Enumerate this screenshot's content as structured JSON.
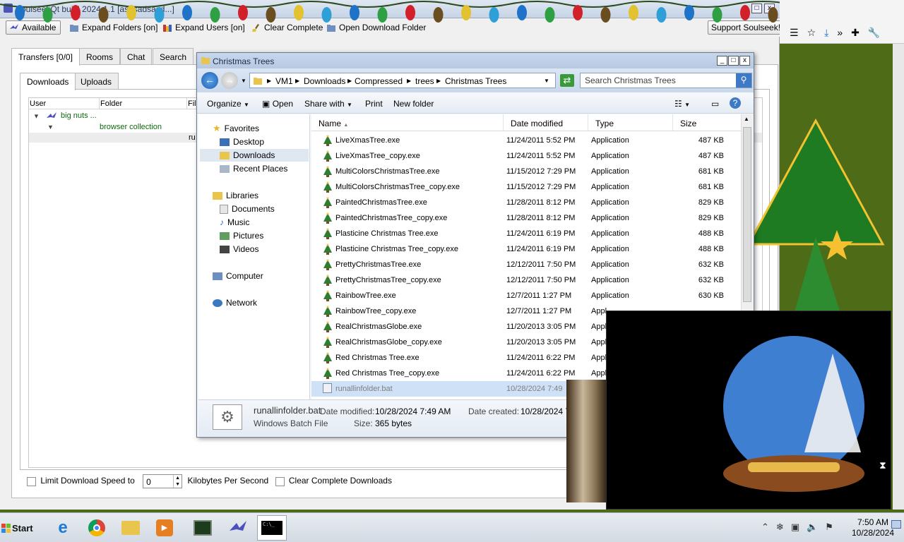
{
  "soulseek": {
    "title": "SoulseekQt build 2024.1.1 [asdsadsasd...]",
    "toolbar": {
      "available": "Available",
      "expand_folders": "Expand Folders [on]",
      "expand_users": "Expand Users [on]",
      "clear_complete": "Clear Complete",
      "open_download_folder": "Open Download Folder",
      "support": "Support Soulseek!"
    },
    "tabs": [
      "Transfers [0/0]",
      "Rooms",
      "Chat",
      "Search"
    ],
    "subtabs": [
      "Downloads",
      "Uploads"
    ],
    "columns": [
      "User",
      "Folder",
      "Fil"
    ],
    "tree": {
      "user": "big nuts ...",
      "folder": "browser collection",
      "file_stub": "ru"
    },
    "bottom": {
      "limit_label": "Limit Download Speed to",
      "speed_value": "0",
      "unit_label": "Kilobytes Per Second",
      "clear_label": "Clear Complete Downloads"
    }
  },
  "explorer": {
    "title": "Christmas Trees",
    "breadcrumb": [
      "VM1",
      "Downloads",
      "Compressed",
      "trees",
      "Christmas Trees"
    ],
    "search_placeholder": "Search Christmas Trees",
    "commands": [
      "Organize",
      "Open",
      "Share with",
      "Print",
      "New folder"
    ],
    "nav": {
      "favorites": "Favorites",
      "desktop": "Desktop",
      "downloads": "Downloads",
      "recent": "Recent Places",
      "libraries": "Libraries",
      "documents": "Documents",
      "music": "Music",
      "pictures": "Pictures",
      "videos": "Videos",
      "computer": "Computer",
      "network": "Network"
    },
    "columns": [
      "Name",
      "Date modified",
      "Type",
      "Size"
    ],
    "files": [
      {
        "name": "LiveXmasTree.exe",
        "date": "11/24/2011 5:52 PM",
        "type": "Application",
        "size": "487 KB"
      },
      {
        "name": "LiveXmasTree_copy.exe",
        "date": "11/24/2011 5:52 PM",
        "type": "Application",
        "size": "487 KB"
      },
      {
        "name": "MultiColorsChristmasTree.exe",
        "date": "11/15/2012 7:29 PM",
        "type": "Application",
        "size": "681 KB"
      },
      {
        "name": "MultiColorsChristmasTree_copy.exe",
        "date": "11/15/2012 7:29 PM",
        "type": "Application",
        "size": "681 KB"
      },
      {
        "name": "PaintedChristmasTree.exe",
        "date": "11/28/2011 8:12 PM",
        "type": "Application",
        "size": "829 KB"
      },
      {
        "name": "PaintedChristmasTree_copy.exe",
        "date": "11/28/2011 8:12 PM",
        "type": "Application",
        "size": "829 KB"
      },
      {
        "name": "Plasticine Christmas Tree.exe",
        "date": "11/24/2011 6:19 PM",
        "type": "Application",
        "size": "488 KB"
      },
      {
        "name": "Plasticine Christmas Tree_copy.exe",
        "date": "11/24/2011 6:19 PM",
        "type": "Application",
        "size": "488 KB"
      },
      {
        "name": "PrettyChristmasTree.exe",
        "date": "12/12/2011 7:50 PM",
        "type": "Application",
        "size": "632 KB"
      },
      {
        "name": "PrettyChristmasTree_copy.exe",
        "date": "12/12/2011 7:50 PM",
        "type": "Application",
        "size": "632 KB"
      },
      {
        "name": "RainbowTree.exe",
        "date": "12/7/2011 1:27 PM",
        "type": "Application",
        "size": "630 KB"
      },
      {
        "name": "RainbowTree_copy.exe",
        "date": "12/7/2011 1:27 PM",
        "type": "Appl",
        "size": ""
      },
      {
        "name": "RealChristmasGlobe.exe",
        "date": "11/20/2013 3:05 PM",
        "type": "Appl",
        "size": ""
      },
      {
        "name": "RealChristmasGlobe_copy.exe",
        "date": "11/20/2013 3:05 PM",
        "type": "Appl",
        "size": ""
      },
      {
        "name": "Red Christmas Tree.exe",
        "date": "11/24/2011 6:22 PM",
        "type": "Appl",
        "size": ""
      },
      {
        "name": "Red Christmas Tree_copy.exe",
        "date": "11/24/2011 6:22 PM",
        "type": "Appl",
        "size": ""
      },
      {
        "name": "runallinfolder.bat",
        "date": "10/28/2024 7:49",
        "type": "",
        "size": ""
      }
    ],
    "details": {
      "name": "runallinfolder.bat",
      "kind": "Windows Batch File",
      "modified_label": "Date modified:",
      "modified": "10/28/2024 7:49 AM",
      "created_label": "Date created:",
      "created": "10/28/2024 7:",
      "size_label": "Size:",
      "size": "365 bytes"
    }
  },
  "taskbar": {
    "start": "Start",
    "time": "7:50 AM",
    "date": "10/28/2024"
  },
  "colors": {
    "olive": "#4e6b18",
    "selection": "#cfe1f7",
    "green_text": "#0b6b0b"
  }
}
